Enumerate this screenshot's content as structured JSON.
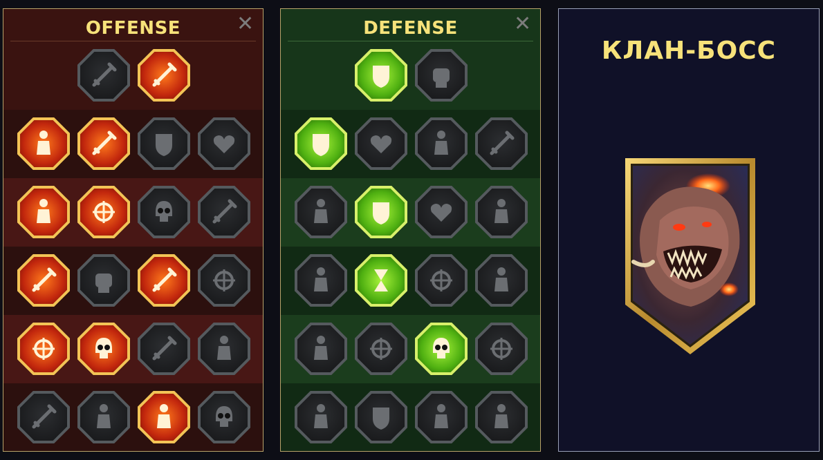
{
  "offense": {
    "title": "OFFENSE",
    "close_glyph": "✕",
    "rows": [
      [
        {
          "icon": "crossed-swords-icon",
          "active": false
        },
        {
          "icon": "sword-slash-icon",
          "active": true
        }
      ],
      [
        {
          "icon": "horned-demon-icon",
          "active": true
        },
        {
          "icon": "sword-wave-icon",
          "active": true
        },
        {
          "icon": "shield-arrow-icon",
          "active": false
        },
        {
          "icon": "broken-heart-icon",
          "active": false
        }
      ],
      [
        {
          "icon": "arrows-body-icon",
          "active": true
        },
        {
          "icon": "fangs-icon",
          "active": true
        },
        {
          "icon": "skull-cloak-icon",
          "active": false
        },
        {
          "icon": "dagger-hand-icon",
          "active": false
        }
      ],
      [
        {
          "icon": "bleeding-sword-icon",
          "active": true
        },
        {
          "icon": "fist-icon",
          "active": false
        },
        {
          "icon": "axe-icon",
          "active": true
        },
        {
          "icon": "chain-lightning-icon",
          "active": false
        }
      ],
      [
        {
          "icon": "arrows-burst-icon",
          "active": true
        },
        {
          "icon": "triple-skull-icon",
          "active": true
        },
        {
          "icon": "sword-circle-icon",
          "active": false
        },
        {
          "icon": "flexing-warrior-icon",
          "active": false
        }
      ],
      [
        {
          "icon": "sparkle-sword-icon",
          "active": false
        },
        {
          "icon": "knight-helmet-icon",
          "active": false
        },
        {
          "icon": "demon-flames-icon",
          "active": true
        },
        {
          "icon": "skull-sword-icon",
          "active": false
        }
      ]
    ]
  },
  "defense": {
    "title": "DEFENSE",
    "close_glyph": "✕",
    "rows": [
      [
        {
          "icon": "scales-armor-icon",
          "active": true
        },
        {
          "icon": "raised-fist-icon",
          "active": false
        }
      ],
      [
        {
          "icon": "chevron-shield-icon",
          "active": true
        },
        {
          "icon": "heart-vial-icon",
          "active": false
        },
        {
          "icon": "stone-golem-icon",
          "active": false
        },
        {
          "icon": "crossed-blades-icon",
          "active": false
        }
      ],
      [
        {
          "icon": "twin-figures-icon",
          "active": false
        },
        {
          "icon": "shield-knight-icon",
          "active": true
        },
        {
          "icon": "heart-circle-icon",
          "active": false
        },
        {
          "icon": "meditating-head-icon",
          "active": false
        }
      ],
      [
        {
          "icon": "crowd-icon",
          "active": false
        },
        {
          "icon": "hourglass-icon",
          "active": true
        },
        {
          "icon": "open-hand-icon",
          "active": false
        },
        {
          "icon": "bull-head-icon",
          "active": false
        }
      ],
      [
        {
          "icon": "dashing-runner-icon",
          "active": false
        },
        {
          "icon": "claw-marks-icon",
          "active": false
        },
        {
          "icon": "radiant-skull-icon",
          "active": true
        },
        {
          "icon": "swirl-hand-icon",
          "active": false
        }
      ],
      [
        {
          "icon": "spiked-warrior-icon",
          "active": false
        },
        {
          "icon": "winged-shield-icon",
          "active": false
        },
        {
          "icon": "masked-face-icon",
          "active": false
        },
        {
          "icon": "strongman-icon",
          "active": false
        }
      ]
    ]
  },
  "boss": {
    "title": "КЛАН-БОСС",
    "image_icon": "clan-boss-portrait-icon"
  },
  "colors": {
    "title": "#f7e27a",
    "offense_active": "#ff5a14",
    "defense_active": "#8ee02a",
    "inactive": "#555a5e"
  }
}
